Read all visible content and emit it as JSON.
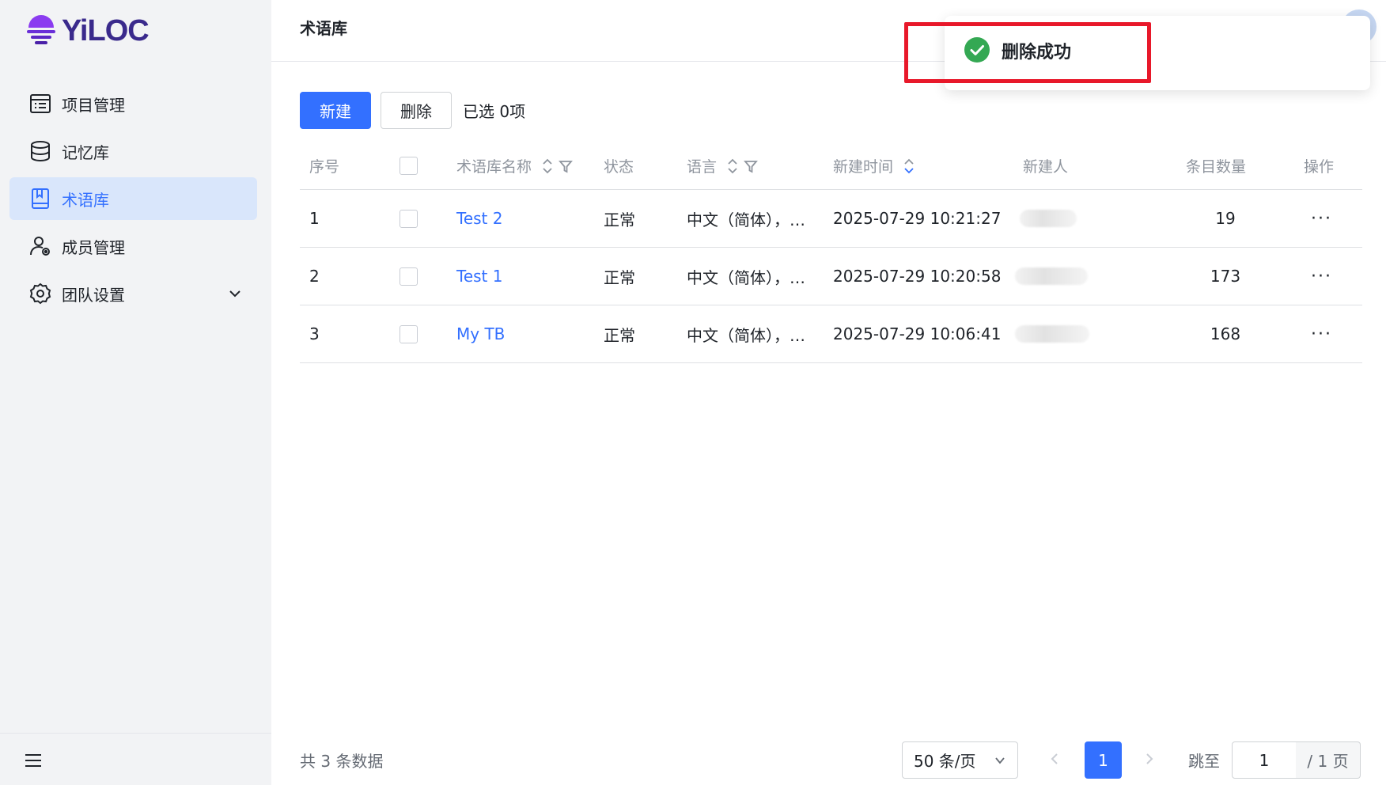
{
  "brand": {
    "name": "YiLOC",
    "color": "#3a2a8c",
    "accent": "#8b3cf0"
  },
  "sidebar": {
    "items": [
      {
        "label": "项目管理",
        "icon": "list-icon"
      },
      {
        "label": "记忆库",
        "icon": "database-icon"
      },
      {
        "label": "术语库",
        "icon": "book-icon",
        "active": true
      },
      {
        "label": "成员管理",
        "icon": "user-settings-icon"
      },
      {
        "label": "团队设置",
        "icon": "gear-icon",
        "expandable": true
      }
    ]
  },
  "header": {
    "title": "术语库"
  },
  "toolbar": {
    "new_label": "新建",
    "delete_label": "删除",
    "selected_text": "已选 0项"
  },
  "table": {
    "columns": {
      "index": "序号",
      "name": "术语库名称",
      "status": "状态",
      "language": "语言",
      "created_time": "新建时间",
      "creator": "新建人",
      "count": "条目数量",
      "actions": "操作"
    },
    "rows": [
      {
        "index": "1",
        "name": "Test 2",
        "status": "正常",
        "language": "中文（简体），…",
        "created_time": "2025-07-29 10:21:27",
        "count": "19",
        "more": "···"
      },
      {
        "index": "2",
        "name": "Test 1",
        "status": "正常",
        "language": "中文（简体），…",
        "created_time": "2025-07-29 10:20:58",
        "count": "173",
        "more": "···"
      },
      {
        "index": "3",
        "name": "My TB",
        "status": "正常",
        "language": "中文（简体），…",
        "created_time": "2025-07-29 10:06:41",
        "count": "168",
        "more": "···"
      }
    ]
  },
  "footer": {
    "total_text": "共 3 条数据",
    "page_size": "50 条/页",
    "current_page": "1",
    "jump_label": "跳至",
    "jump_value": "1",
    "total_pages": "/ 1 页"
  },
  "toast": {
    "message": "删除成功",
    "icon": "check-circle-icon",
    "icon_color": "#34a853"
  },
  "colors": {
    "primary": "#3370ff",
    "sidebar_active_bg": "#d9e6fb",
    "highlight": "#e8182a"
  }
}
